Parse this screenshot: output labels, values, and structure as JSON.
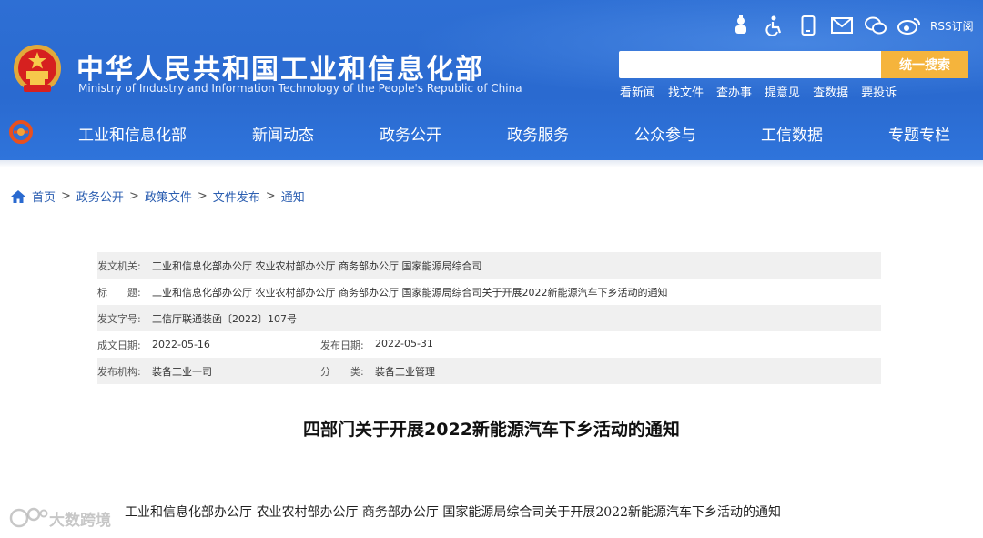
{
  "header": {
    "title": "中华人民共和国工业和信息化部",
    "subtitle": "Ministry of Industry and Information Technology of the People's Republic of China",
    "rss_label": "RSS订阅",
    "search": {
      "placeholder": "",
      "button_label": "统一搜索"
    },
    "quick_links": [
      "看新闻",
      "找文件",
      "查办事",
      "提意见",
      "查数据",
      "要投诉"
    ],
    "icons": [
      "robot-icon",
      "accessibility-icon",
      "mobile-icon",
      "mail-icon",
      "wechat-icon",
      "weibo-icon"
    ]
  },
  "nav": {
    "items": [
      "工业和信息化部",
      "新闻动态",
      "政务公开",
      "政务服务",
      "公众参与",
      "工信数据",
      "专题专栏"
    ]
  },
  "breadcrumb": [
    "首页",
    "政务公开",
    "政策文件",
    "文件发布",
    "通知"
  ],
  "meta": {
    "issuer_label": "发文机关:",
    "issuer": "工业和信息化部办公厅 农业农村部办公厅 商务部办公厅 国家能源局综合司",
    "title_label": "标　　题:",
    "title": "工业和信息化部办公厅 农业农村部办公厅 商务部办公厅 国家能源局综合司关于开展2022新能源汽车下乡活动的通知",
    "doc_no_label": "发文字号:",
    "doc_no": "工信厅联通装函〔2022〕107号",
    "written_label": "成文日期:",
    "written_date": "2022-05-16",
    "published_label": "发布日期:",
    "published_date": "2022-05-31",
    "org_label": "发布机构:",
    "org": "装备工业一司",
    "category_label": "分　　类:",
    "category": "装备工业管理"
  },
  "document": {
    "heading": "四部门关于开展2022新能源汽车下乡活动的通知",
    "body_first_line": "工业和信息化部办公厅 农业农村部办公厅 商务部办公厅 国家能源局综合司关于开展2022新能源汽车下乡活动的通知"
  },
  "watermark": "大数跨境",
  "colors": {
    "header_blue": "#2e6fd4",
    "search_button": "#f5b43c",
    "link_blue": "#2a5db0"
  }
}
